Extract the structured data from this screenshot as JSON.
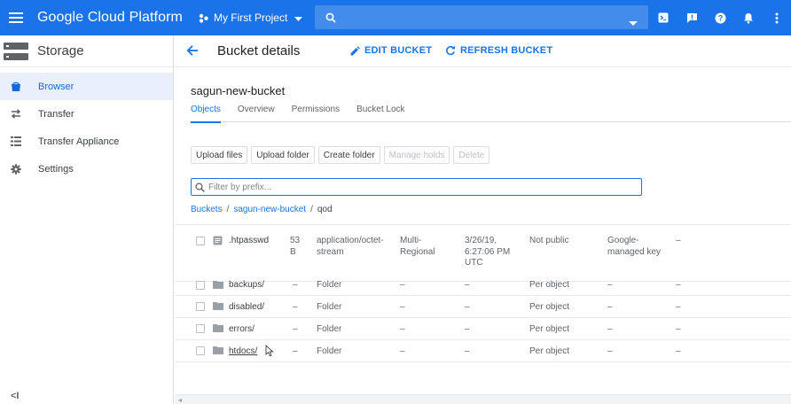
{
  "topbar": {
    "app_title": "Google Cloud Platform",
    "project": "My First Project",
    "icons": [
      "menu-icon",
      "search-icon",
      "cloud-shell-icon",
      "feedback-icon",
      "help-icon",
      "notifications-icon",
      "more-vert-icon"
    ]
  },
  "sidebar": {
    "title": "Storage",
    "items": [
      {
        "label": "Browser",
        "icon": "bucket-icon",
        "active": true
      },
      {
        "label": "Transfer",
        "icon": "transfer-icon"
      },
      {
        "label": "Transfer Appliance",
        "icon": "list-icon"
      },
      {
        "label": "Settings",
        "icon": "gear-icon"
      }
    ],
    "collapse": "<I"
  },
  "header": {
    "title": "Bucket details",
    "edit_label": "EDIT BUCKET",
    "refresh_label": "REFRESH BUCKET"
  },
  "bucket": {
    "name": "sagun-new-bucket",
    "tabs": [
      "Objects",
      "Overview",
      "Permissions",
      "Bucket Lock"
    ],
    "active_tab": "Objects"
  },
  "actions": {
    "upload_files": "Upload files",
    "upload_folder": "Upload folder",
    "create_folder": "Create folder",
    "manage_holds": "Manage holds",
    "delete": "Delete"
  },
  "filter": {
    "placeholder": "Filter by prefix..."
  },
  "breadcrumb": {
    "root": "Buckets",
    "bucket": "sagun-new-bucket",
    "current": "qod",
    "sep": "/"
  },
  "files": [
    {
      "name": ".htpasswd",
      "size": "53\nB",
      "type": "application/octet-\nstream",
      "storage_class": "Multi-\nRegional",
      "modified": "3/26/19,\n6:27:06 PM\nUTC",
      "access": "Not public",
      "encryption": "Google-\nmanaged key",
      "retention": "–",
      "kind": "file"
    },
    {
      "name": "backups/",
      "size": "–",
      "type": "Folder",
      "storage_class": "–",
      "modified": "–",
      "access": "Per object",
      "encryption": "–",
      "retention": "–",
      "kind": "folder"
    },
    {
      "name": "disabled/",
      "size": "–",
      "type": "Folder",
      "storage_class": "–",
      "modified": "–",
      "access": "Per object",
      "encryption": "–",
      "retention": "–",
      "kind": "folder"
    },
    {
      "name": "errors/",
      "size": "–",
      "type": "Folder",
      "storage_class": "–",
      "modified": "–",
      "access": "Per object",
      "encryption": "–",
      "retention": "–",
      "kind": "folder"
    },
    {
      "name": "htdocs/",
      "size": "–",
      "type": "Folder",
      "storage_class": "–",
      "modified": "–",
      "access": "Per object",
      "encryption": "–",
      "retention": "–",
      "kind": "folder"
    }
  ],
  "colors": {
    "primary": "#1a73e8",
    "active_bg": "#e8f0fe"
  }
}
